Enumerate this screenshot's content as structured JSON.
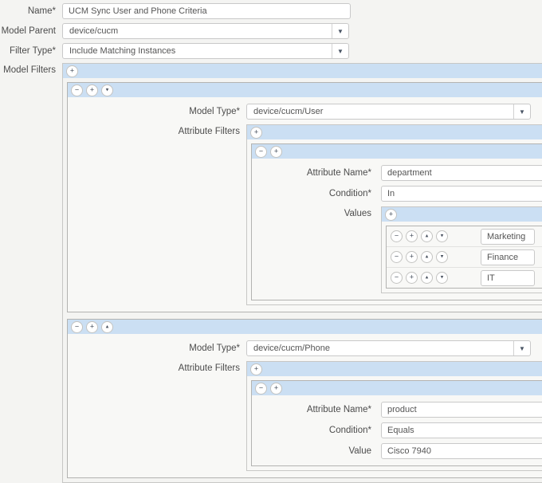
{
  "icons": {
    "add": "+",
    "remove": "−",
    "move_up": "▴",
    "move_down": "▾",
    "dropdown": "▼"
  },
  "form": {
    "name": {
      "label": "Name*",
      "value": "UCM Sync User and Phone Criteria"
    },
    "model_parent": {
      "label": "Model Parent",
      "value": "device/cucm"
    },
    "filter_type": {
      "label": "Filter Type*",
      "value": "Include Matching Instances"
    },
    "model_filters": {
      "label": "Model Filters",
      "items": [
        {
          "model_type": {
            "label": "Model Type*",
            "value": "device/cucm/User"
          },
          "attribute_filters": {
            "label": "Attribute Filters",
            "items": [
              {
                "attribute_name": {
                  "label": "Attribute Name*",
                  "value": "department"
                },
                "condition": {
                  "label": "Condition*",
                  "value": "In"
                },
                "values": {
                  "label": "Values",
                  "items": [
                    "Marketing",
                    "Finance",
                    "IT"
                  ]
                }
              }
            ]
          }
        },
        {
          "model_type": {
            "label": "Model Type*",
            "value": "device/cucm/Phone"
          },
          "attribute_filters": {
            "label": "Attribute Filters",
            "items": [
              {
                "attribute_name": {
                  "label": "Attribute Name*",
                  "value": "product"
                },
                "condition": {
                  "label": "Condition*",
                  "value": "Equals"
                },
                "value": {
                  "label": "Value",
                  "value": "Cisco 7940"
                }
              }
            ]
          }
        }
      ]
    }
  }
}
